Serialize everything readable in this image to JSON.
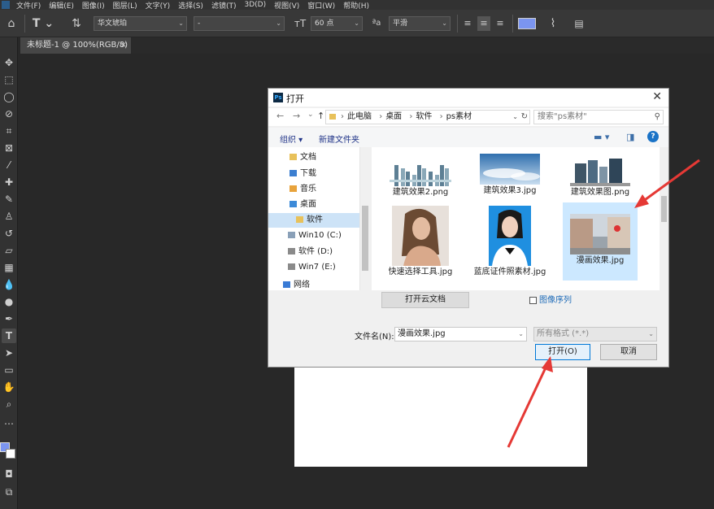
{
  "menu": [
    "文件(F)",
    "编辑(E)",
    "图像(I)",
    "图层(L)",
    "文字(Y)",
    "选择(S)",
    "滤镜(T)",
    "3D(D)",
    "视图(V)",
    "窗口(W)",
    "帮助(H)"
  ],
  "options": {
    "font_family": "华文琥珀",
    "font_style": "-",
    "font_size": "60 点",
    "antialias": "平滑",
    "text_color": "#7b95f0"
  },
  "document_tab": {
    "title": "未标题-1 @ 100%(RGB/8)",
    "close": "×"
  },
  "dialog": {
    "title": "打开",
    "close": "✕",
    "nav": {
      "back": "←",
      "forward": "→",
      "recent": "⌄",
      "up": "↑"
    },
    "breadcrumb": [
      "此电脑",
      "桌面",
      "软件",
      "ps素材"
    ],
    "search_placeholder": "搜索\"ps素材\"",
    "commands": {
      "organize": "组织 ▾",
      "new_folder": "新建文件夹"
    },
    "nav_items": [
      {
        "label": "文档",
        "icon": "documents-folder-icon",
        "color": "#e8c15a"
      },
      {
        "label": "下载",
        "icon": "downloads-folder-icon",
        "color": "#3c7fd0"
      },
      {
        "label": "音乐",
        "icon": "music-folder-icon",
        "color": "#e8a33c"
      },
      {
        "label": "桌面",
        "icon": "desktop-folder-icon",
        "color": "#3c8ad8"
      },
      {
        "label": "软件",
        "icon": "folder-icon",
        "color": "#e8c15a"
      },
      {
        "label": "Win10 (C:)",
        "icon": "drive-icon",
        "color": "#8aa0b8"
      },
      {
        "label": "软件 (D:)",
        "icon": "drive-icon",
        "color": "#8a8a8a"
      },
      {
        "label": "Win7 (E:)",
        "icon": "drive-icon",
        "color": "#8a8a8a"
      },
      {
        "label": "网络",
        "icon": "network-icon",
        "color": "#3a7bd5"
      }
    ],
    "files": [
      {
        "name": "建筑效果2.png",
        "thumb": "skyline"
      },
      {
        "name": "建筑效果3.jpg",
        "thumb": "sky"
      },
      {
        "name": "建筑效果图.png",
        "thumb": "buildings"
      },
      {
        "name": "快速选择工具.jpg",
        "thumb": "portrait"
      },
      {
        "name": "蓝底证件照素材.jpg",
        "thumb": "idphoto"
      },
      {
        "name": "漫画效果.jpg",
        "thumb": "street"
      }
    ],
    "open_cloud": "打开云文档",
    "image_sequence": "图像序列",
    "filename_label": "文件名(N):",
    "filename_value": "漫画效果.jpg",
    "filetype": "所有格式 (*.*)",
    "open_button": "打开(O)",
    "cancel_button": "取消"
  }
}
